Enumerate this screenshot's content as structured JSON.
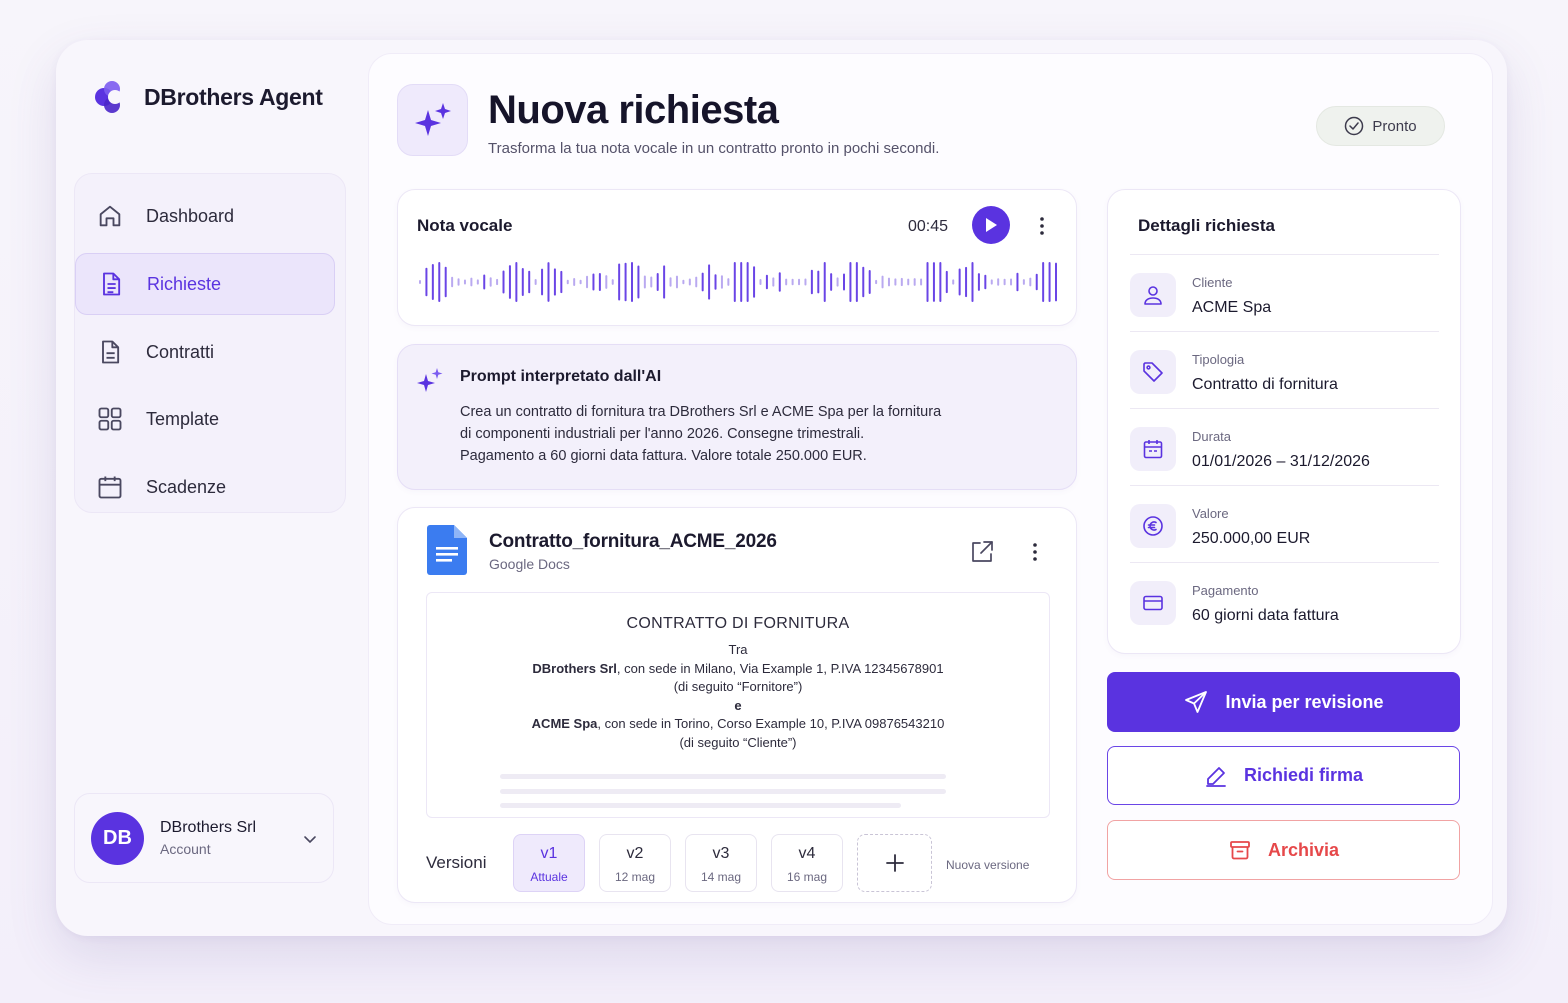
{
  "app": {
    "title": "DBrothers Agent"
  },
  "sidebar": {
    "items": [
      {
        "label": "Dashboard",
        "icon": "home-icon"
      },
      {
        "label": "Richieste",
        "icon": "document-icon",
        "active": true
      },
      {
        "label": "Contratti",
        "icon": "file-icon"
      },
      {
        "label": "Template",
        "icon": "grid-icon"
      },
      {
        "label": "Scadenze",
        "icon": "calendar-icon"
      }
    ],
    "account": {
      "initials": "DB",
      "name": "DBrothers Srl",
      "sub": "Account"
    }
  },
  "header": {
    "title": "Nuova richiesta",
    "subtitle": "Trasforma la tua nota vocale in un contratto pronto in pochi secondi.",
    "status": "Pronto"
  },
  "voice": {
    "title": "Nota vocale",
    "time": "00:45"
  },
  "prompt": {
    "title": "Prompt interpretato dall'AI",
    "lines": [
      "Crea un contratto di fornitura tra DBrothers Srl e ACME Spa per la fornitura",
      "di componenti industriali per l'anno 2026. Consegne trimestrali.",
      "Pagamento a 60 giorni data fattura. Valore totale 250.000 EUR."
    ]
  },
  "document": {
    "name": "Contratto_fornitura_ACME_2026",
    "source": "Google Docs",
    "preview": {
      "title": "CONTRATTO DI FORNITURA",
      "tra": "Tra",
      "party1_name": "DBrothers Srl",
      "party1_rest": ", con sede in Milano, Via Example 1, P.IVA 12345678901",
      "party1_role": "(di seguito “Fornitore”)",
      "and": "e",
      "party2_name": "ACME Spa",
      "party2_rest": ", con sede in Torino, Corso Example 10, P.IVA 09876543210",
      "party2_role": "(di seguito “Cliente”)"
    },
    "versions_label": "Versioni",
    "versions": [
      {
        "name": "v1",
        "date": "Attuale",
        "active": true
      },
      {
        "name": "v2",
        "date": "12 mag"
      },
      {
        "name": "v3",
        "date": "14 mag"
      },
      {
        "name": "v4",
        "date": "16 mag"
      }
    ],
    "new_version_label": "Nuova versione"
  },
  "details": {
    "title": "Dettagli richiesta",
    "rows": [
      {
        "label": "Cliente",
        "value": "ACME Spa",
        "icon": "user-icon"
      },
      {
        "label": "Tipologia",
        "value": "Contratto di fornitura",
        "icon": "tag-icon"
      },
      {
        "label": "Durata",
        "value": "01/01/2026 – 31/12/2026",
        "icon": "calendar-icon"
      },
      {
        "label": "Valore",
        "value": "250.000,00 EUR",
        "icon": "euro-icon"
      },
      {
        "label": "Pagamento",
        "value": "60 giorni data fattura",
        "icon": "card-icon"
      }
    ]
  },
  "actions": {
    "send_review": "Invia per revisione",
    "request_signature": "Richiedi firma",
    "archive": "Archivia"
  },
  "colors": {
    "accent": "#5a33e0",
    "danger": "#e6484a",
    "background": "#f8f6fc"
  }
}
